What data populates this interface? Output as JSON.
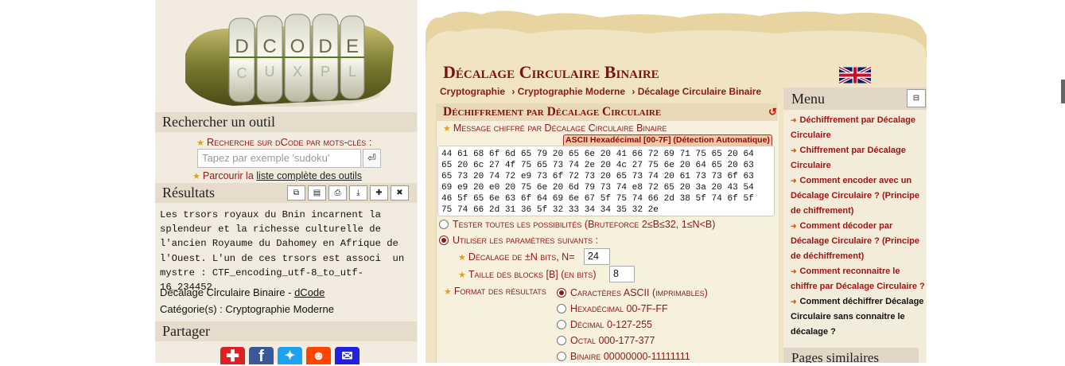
{
  "left": {
    "search_heading": "Rechercher un outil",
    "search_label": "Recherche sur dCode par mots-clés :",
    "search_placeholder": "Tapez par exemple 'sudoku'",
    "search_button": "⏎",
    "browse_prefix": "Parcourir la ",
    "browse_link": "liste complète des outils",
    "results_heading": "Résultats",
    "results_text": "Les trsors royaux du Bnin incarnent la\nsplendeur et la richesse culturelle de\nl'ancien Royaume du Dahomey en Afrique de\nl'Ouest. L'un de ces trsors est associ  un\nmystre : CTF_encoding_utf-8_to_utf-16_234452.",
    "result_tool_prefix": "Décalage Circulaire Binaire - ",
    "result_tool_link": "dCode",
    "result_category": "Catégorie(s) : Cryptographie Moderne",
    "share_heading": "Partager",
    "logo_letters": [
      "D",
      "C",
      "O",
      "D",
      "E"
    ]
  },
  "main": {
    "title": "Décalage Circulaire Binaire",
    "breadcrumbs": [
      "Cryptographie",
      "› Cryptographie Moderne",
      "› Décalage Circulaire Binaire"
    ],
    "panel_heading": "Déchiffrement par Décalage Circulaire",
    "message_label": "Message chiffré par Décalage Circulaire Binaire",
    "detect_badge": "ASCII Hexadécimal [00-7F] (Détection Automatique)",
    "ciphertext": "44 61 68 6f 6d 65 79 20 65 6e 20 41 66 72 69 71 75 65 20 64\n65 20 6c 27 4f 75 65 73 74 2e 20 4c 27 75 6e 20 64 65 20 63\n65 73 20 74 72 e9 73 6f 72 73 20 65 73 74 20 61 73 73 6f 63\n69 e9 20 e0 20 75 6e 20 6d 79 73 74 e8 72 65 20 3a 20 43 54\n46 5f 65 6e 63 6f 64 69 6e 67 5f 75 74 66 2d 38 5f 74 6f 5f\n75 74 66 2d 31 36 5f 32 33 34 34 35 32 2e",
    "opt_bruteforce": "Tester toutes les possibilités (Bruteforce 2≤B≤32, 1≤N<B)",
    "opt_params": "Utiliser les paramètres suivants :",
    "shift_label": "Décalage de ±N bits, N=",
    "shift_value": "24",
    "block_label": "Taille des blocks [B] (en bits)",
    "block_value": "8",
    "format_label": "Format des résultats",
    "formats": [
      "Caractères ASCII (imprimables)",
      "Hexadécimal 00-7F-FF",
      "Décimal 0-127-255",
      "Octal 000-177-377",
      "Binaire 00000000-11111111"
    ],
    "selected_format": 0
  },
  "menu": {
    "heading": "Menu",
    "toggle": "⊟",
    "items": [
      "Déchiffrement par Décalage Circulaire",
      "Chiffrement par Décalage Circulaire",
      "Comment encoder avec un Décalage Circulaire ? (Principe de chiffrement)",
      "Comment décoder par Décalage Circulaire ? (Principe de déchiffrement)",
      "Comment reconnaitre le chiffre par Décalage Circulaire ?",
      "Comment déchiffrer Décalage Circulaire sans connaitre le décalage ?"
    ],
    "similar_heading": "Pages similaires"
  },
  "colors": {
    "accent": "#8a1a1a",
    "parchment": "#f1e4c2",
    "share_plus": "#e02020",
    "share_facebook": "#3b5998",
    "share_twitter": "#1da1f2",
    "share_reddit": "#ff4500",
    "share_email": "#2020e0"
  }
}
